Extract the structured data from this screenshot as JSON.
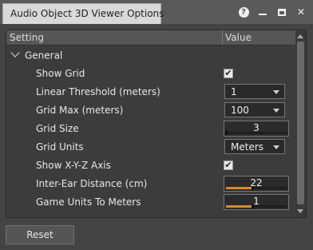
{
  "window": {
    "title": "Audio Object 3D Viewer Options"
  },
  "controls": {
    "help": "?",
    "close": "✕"
  },
  "table": {
    "col_setting": "Setting",
    "col_value": "Value",
    "group": "General",
    "rows": [
      {
        "label": "Show Grid",
        "type": "checkbox",
        "checked": true
      },
      {
        "label": "Linear Threshold (meters)",
        "type": "dropdown",
        "value": "1"
      },
      {
        "label": "Grid Max (meters)",
        "type": "dropdown",
        "value": "100"
      },
      {
        "label": "Grid Size",
        "type": "number",
        "value": "3",
        "fill": 0.0
      },
      {
        "label": "Grid Units",
        "type": "dropdown",
        "value": "Meters"
      },
      {
        "label": "Show X-Y-Z Axis",
        "type": "checkbox",
        "checked": true
      },
      {
        "label": "Inter-Ear Distance (cm)",
        "type": "number",
        "value": "22",
        "fill": 0.44
      },
      {
        "label": "Game Units To Meters",
        "type": "number",
        "value": "1",
        "fill": 0.44
      }
    ]
  },
  "footer": {
    "reset_label": "Reset"
  },
  "colors": {
    "accent": "#d8892b",
    "background": "#444444"
  }
}
